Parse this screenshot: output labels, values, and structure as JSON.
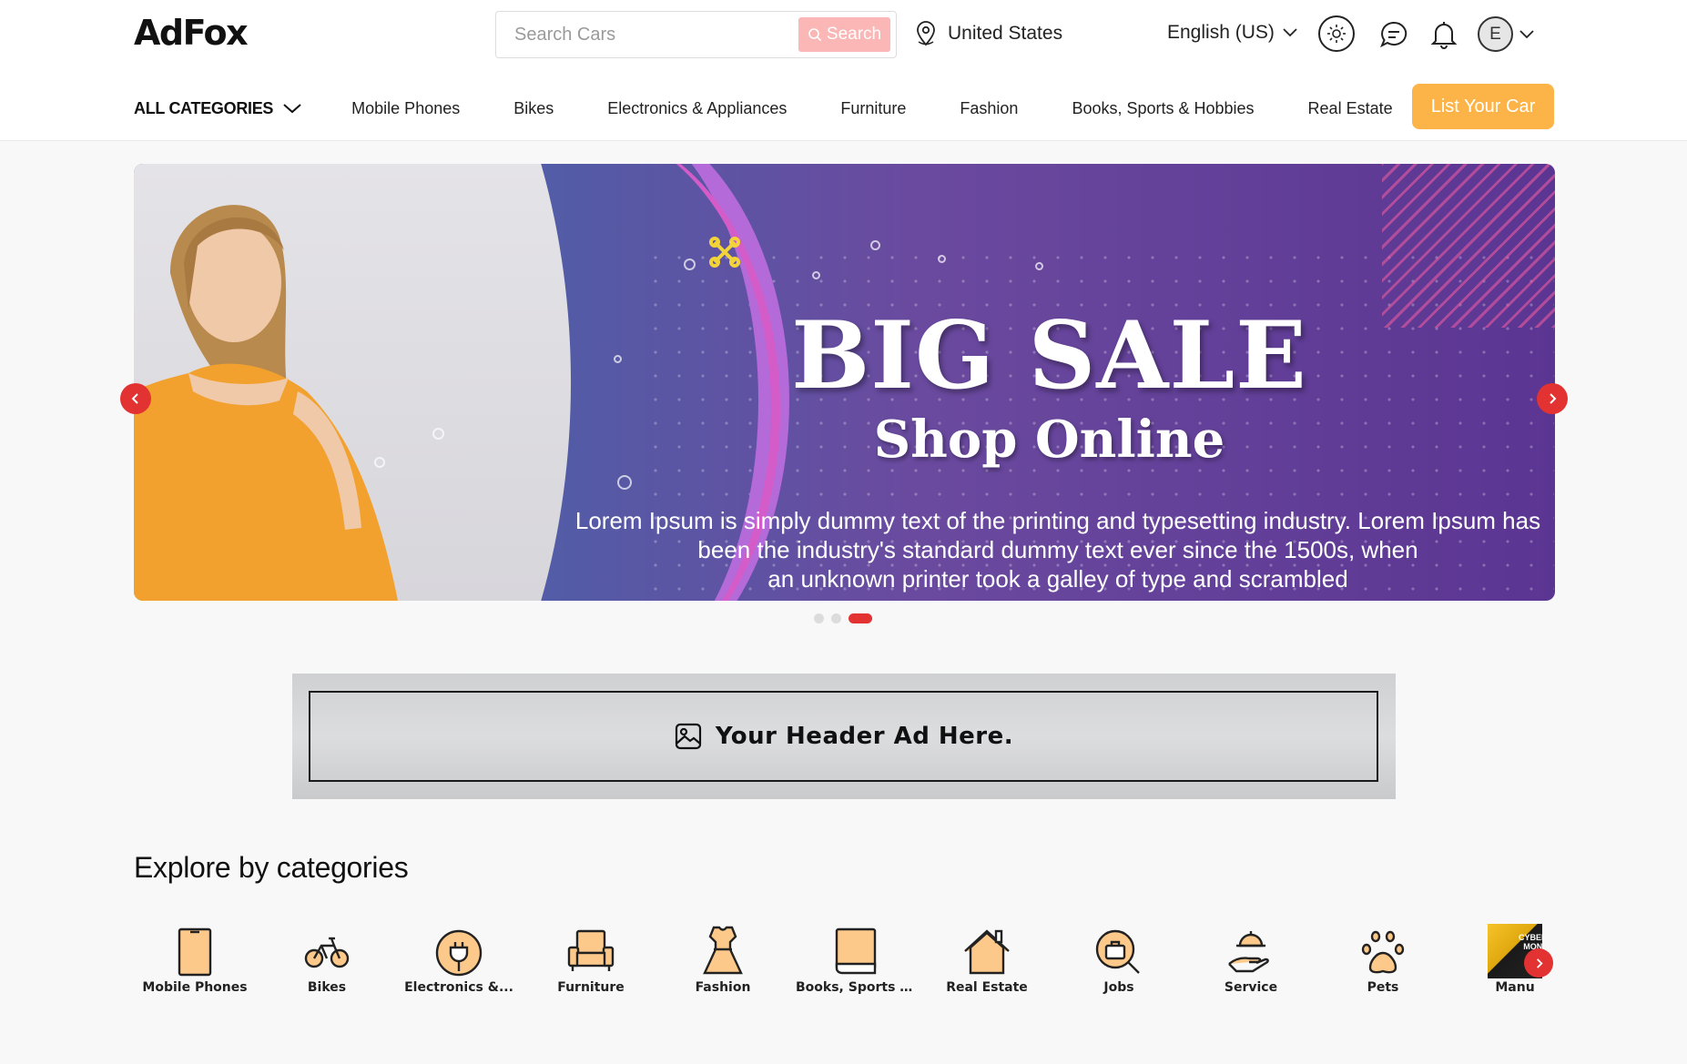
{
  "header": {
    "logo": "AdFox",
    "search": {
      "placeholder": "Search Cars",
      "button_label": "Search"
    },
    "location": "United States",
    "language": "English (US)",
    "avatar_initial": "E"
  },
  "nav": {
    "all_categories": "ALL CATEGORIES",
    "items": [
      {
        "label": "Mobile Phones"
      },
      {
        "label": "Bikes"
      },
      {
        "label": "Electronics & Appliances"
      },
      {
        "label": "Furniture"
      },
      {
        "label": "Fashion"
      },
      {
        "label": "Books, Sports & Hobbies"
      },
      {
        "label": "Real Estate"
      }
    ],
    "cta_label": "List Your Car"
  },
  "banner": {
    "headline": "BIG SALE",
    "subheadline": "Shop Online",
    "body_lines": [
      "Lorem Ipsum is simply dummy text of the printing and typesetting industry. Lorem Ipsum has",
      "been the industry's standard dummy text ever since the 1500s, when",
      "an unknown printer took a galley of type and scrambled"
    ],
    "slide_count": 3,
    "active_slide": 3
  },
  "ad": {
    "text": "Your Header Ad Here."
  },
  "categories": {
    "title": "Explore by categories",
    "items": [
      {
        "label": "Mobile Phones",
        "icon": "mobile-phone-icon"
      },
      {
        "label": "Bikes",
        "icon": "bicycle-icon"
      },
      {
        "label": "Electronics &...",
        "icon": "plug-icon"
      },
      {
        "label": "Furniture",
        "icon": "armchair-icon"
      },
      {
        "label": "Fashion",
        "icon": "dress-icon"
      },
      {
        "label": "Books, Sports ...",
        "icon": "book-icon"
      },
      {
        "label": "Real Estate",
        "icon": "house-icon"
      },
      {
        "label": "Jobs",
        "icon": "job-search-icon"
      },
      {
        "label": "Service",
        "icon": "service-bell-icon"
      },
      {
        "label": "Pets",
        "icon": "paw-icon"
      },
      {
        "label": "Manu",
        "icon": "category-thumbnail",
        "thumb_text": "CYBER MON"
      }
    ]
  },
  "colors": {
    "accent_red": "#e23232",
    "cta_orange": "#fcb448",
    "icon_fill": "#fcc98a",
    "search_button": "#fbb6b6"
  }
}
